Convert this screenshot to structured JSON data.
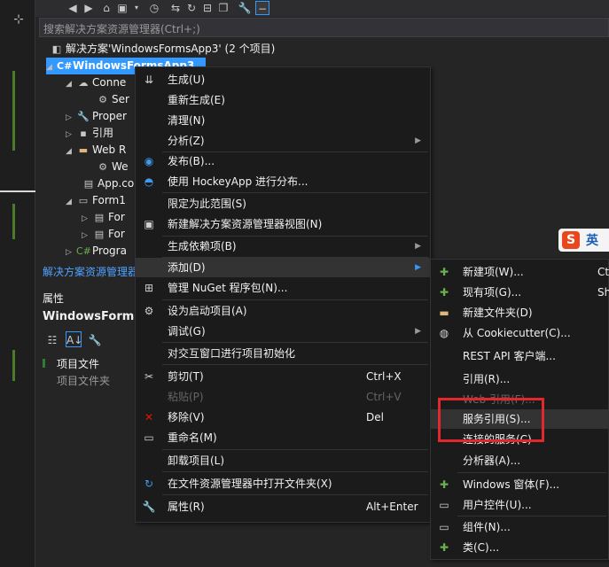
{
  "search_placeholder": "搜索解决方案资源管理器(Ctrl+;)",
  "toolbar_icons": [
    "back-icon",
    "forward-icon",
    "home-icon",
    "project-icon",
    "dropdown-icon",
    "history-icon",
    "sync-icon",
    "refresh-icon",
    "collapse-icon",
    "copy-icon",
    "wrench-icon",
    "minus-icon"
  ],
  "tree": {
    "solution": "解决方案'WindowsFormsApp3' (2 个项目)",
    "project": "WindowsFormsApp3",
    "items": [
      {
        "label": "Conne"
      },
      {
        "label": "Ser"
      },
      {
        "label": "Proper"
      },
      {
        "label": "引用"
      },
      {
        "label": "Web R"
      },
      {
        "label": "We"
      },
      {
        "label": "App.co"
      },
      {
        "label": "Form1"
      },
      {
        "label": "For"
      },
      {
        "label": "For"
      },
      {
        "label": "Progra"
      }
    ]
  },
  "se_footer": "解决方案资源管理器",
  "properties": {
    "title": "属性",
    "object": "WindowsFormsA",
    "rows": [
      "项目文件",
      "项目文件夹"
    ]
  },
  "context_menu": {
    "items": [
      {
        "label": "生成(U)"
      },
      {
        "label": "重新生成(E)"
      },
      {
        "label": "清理(N)"
      },
      {
        "label": "分析(Z)"
      },
      {
        "label": "发布(B)..."
      },
      {
        "label": "使用 HockeyApp 进行分布..."
      },
      {
        "label": "限定为此范围(S)"
      },
      {
        "label": "新建解决方案资源管理器视图(N)"
      },
      {
        "label": "生成依赖项(B)"
      },
      {
        "label": "添加(D)"
      },
      {
        "label": "管理 NuGet 程序包(N)..."
      },
      {
        "label": "设为启动项目(A)"
      },
      {
        "label": "调试(G)"
      },
      {
        "label": "对交互窗口进行项目初始化"
      },
      {
        "label": "剪切(T)",
        "key": "Ctrl+X"
      },
      {
        "label": "粘贴(P)",
        "key": "Ctrl+V"
      },
      {
        "label": "移除(V)",
        "key": "Del"
      },
      {
        "label": "重命名(M)"
      },
      {
        "label": "卸载项目(L)"
      },
      {
        "label": "在文件资源管理器中打开文件夹(X)"
      },
      {
        "label": "属性(R)",
        "key": "Alt+Enter"
      }
    ]
  },
  "add_submenu": {
    "items": [
      {
        "label": "新建项(W)...",
        "key": "Ct"
      },
      {
        "label": "现有项(G)...",
        "key": "Sh"
      },
      {
        "label": "新建文件夹(D)"
      },
      {
        "label": "从 Cookiecutter(C)..."
      },
      {
        "label": "REST API 客户端..."
      },
      {
        "label": "引用(R)..."
      },
      {
        "label": "Web 引用(F)..."
      },
      {
        "label": "服务引用(S)..."
      },
      {
        "label": "连接的服务(C)"
      },
      {
        "label": "分析器(A)..."
      },
      {
        "label": "Windows 窗体(F)..."
      },
      {
        "label": "用户控件(U)..."
      },
      {
        "label": "组件(N)..."
      },
      {
        "label": "类(C)..."
      }
    ]
  },
  "ime_badge": {
    "logo": "S",
    "mode": "英"
  }
}
